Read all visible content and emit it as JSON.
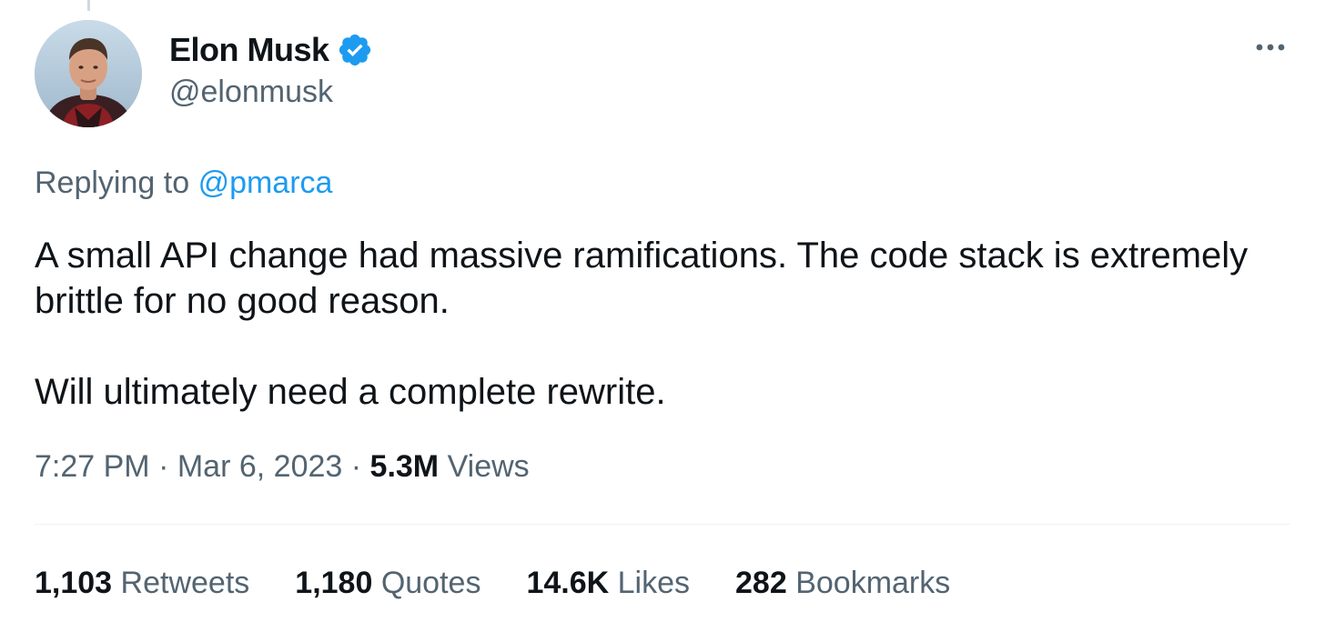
{
  "author": {
    "display_name": "Elon Musk",
    "handle": "@elonmusk",
    "verified": true
  },
  "reply": {
    "prefix": "Replying to",
    "mention": "@pmarca"
  },
  "tweet": {
    "paragraphs": [
      "A small API change had massive ramifications. The code stack is extremely brittle for no good reason.",
      "Will ultimately need a complete rewrite."
    ]
  },
  "meta": {
    "time": "7:27 PM",
    "separator": "·",
    "date": "Mar 6, 2023",
    "views_count": "5.3M",
    "views_label": "Views"
  },
  "stats": [
    {
      "count": "1,103",
      "label": "Retweets"
    },
    {
      "count": "1,180",
      "label": "Quotes"
    },
    {
      "count": "14.6K",
      "label": "Likes"
    },
    {
      "count": "282",
      "label": "Bookmarks"
    }
  ],
  "icons": {
    "verified": "verified-badge-icon",
    "more": "more-options-icon"
  },
  "colors": {
    "accent": "#1d9bf0",
    "text_primary": "#0f1419",
    "text_secondary": "#536471",
    "divider": "#eff3f4"
  }
}
